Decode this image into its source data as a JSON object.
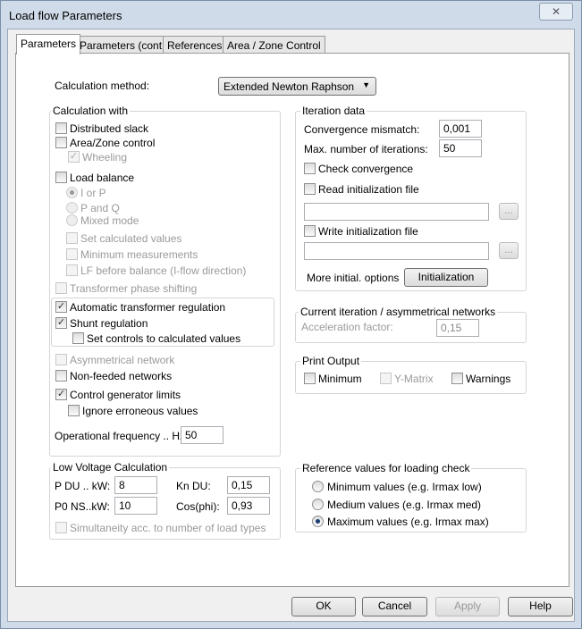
{
  "window": {
    "title": "Load flow Parameters",
    "close_icon": "x"
  },
  "tabs": [
    {
      "label": "Parameters",
      "active": true
    },
    {
      "label": "Parameters (cont.)"
    },
    {
      "label": "References"
    },
    {
      "label": "Area / Zone Control"
    }
  ],
  "calc_method": {
    "label": "Calculation method:",
    "value": "Extended Newton Raphson"
  },
  "calc_with": {
    "title": "Calculation with",
    "distributed_slack": "Distributed slack",
    "area_zone": "Area/Zone control",
    "wheeling": "Wheeling",
    "load_balance": "Load balance",
    "i_or_p": "I or P",
    "p_and_q": "P and Q",
    "mixed": "Mixed mode",
    "set_calc": "Set calculated values",
    "min_meas": "Minimum measurements",
    "lf_before": "LF before balance (I-flow direction)",
    "trafo_phase": "Transformer phase shifting",
    "auto_trafo": "Automatic transformer regulation",
    "shunt": "Shunt regulation",
    "set_controls": "Set controls to calculated values",
    "asym": "Asymmetrical network",
    "non_feeded": "Non-feeded networks",
    "control_gen": "Control generator limits",
    "ignore_err": "Ignore erroneous values",
    "freq_label": "Operational frequency .. Hz:",
    "freq_value": "50"
  },
  "low_voltage": {
    "title": "Low Voltage Calculation",
    "pdu_label": "P DU .. kW:",
    "pdu": "8",
    "kndu_label": "Kn DU:",
    "kndu": "0,15",
    "p0_label": "P0 NS..kW:",
    "p0": "10",
    "cos_label": "Cos(phi):",
    "cos": "0,93",
    "simult": "Simultaneity acc. to number of load types"
  },
  "iteration": {
    "title": "Iteration data",
    "conv_label": "Convergence mismatch:",
    "conv": "0,001",
    "maxit_label": "Max. number of iterations:",
    "maxit": "50",
    "check_conv": "Check convergence",
    "read_init": "Read initialization file",
    "read_path": "",
    "write_init": "Write initialization file",
    "write_path": "",
    "browse": "...",
    "more_label": "More initial. options",
    "init_button": "Initialization"
  },
  "current": {
    "title": "Current iteration / asymmetrical networks",
    "accel_label": "Acceleration factor:",
    "accel": "0,15"
  },
  "print": {
    "title": "Print Output",
    "minimum": "Minimum",
    "ymatrix": "Y-Matrix",
    "warnings": "Warnings"
  },
  "reference": {
    "title": "Reference values for loading check",
    "min": "Minimum values (e.g. Irmax low)",
    "med": "Medium values (e.g. Irmax med)",
    "max": "Maximum values (e.g. Irmax max)"
  },
  "buttons": {
    "ok": "OK",
    "cancel": "Cancel",
    "apply": "Apply",
    "help": "Help"
  }
}
